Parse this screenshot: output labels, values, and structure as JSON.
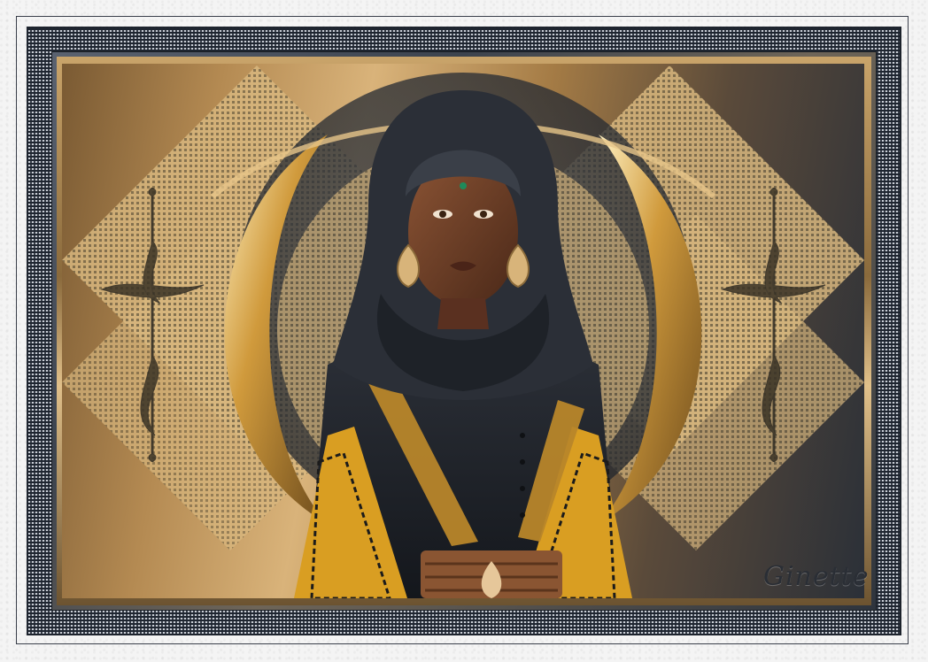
{
  "artwork": {
    "signature": "Ginette",
    "subject": "",
    "palette": {
      "gold": "#d9b37a",
      "dark_gold": "#7a5a33",
      "slate": "#2b3038",
      "cloth_black": "#22262d",
      "skin": "#6b3f27",
      "fabric_yellow": "#e0a92a",
      "belt_brown": "#8a5532"
    }
  },
  "frame": {
    "outer_color": "#f4f4f4",
    "mesh_color": "#2a313c",
    "rim_color": "#c9a46a"
  }
}
